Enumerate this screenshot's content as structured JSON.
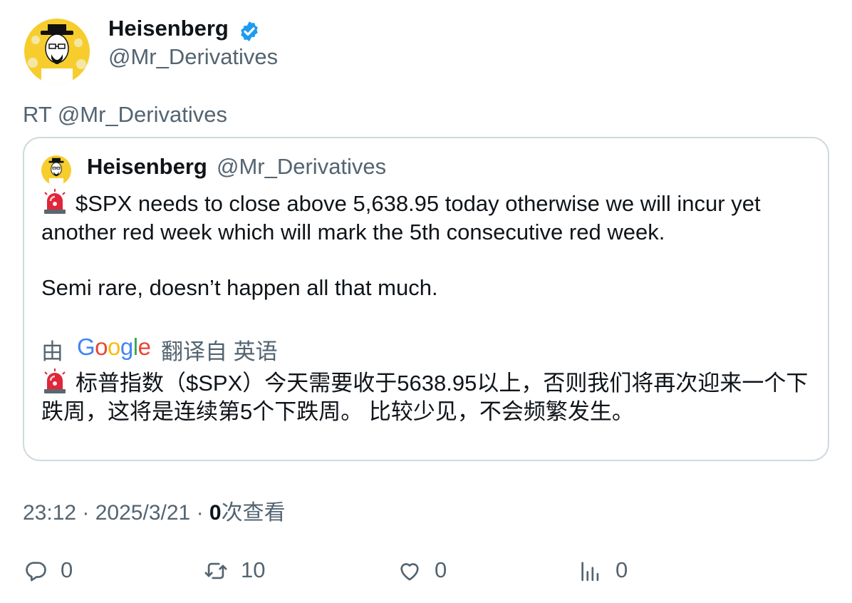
{
  "author": {
    "name": "Heisenberg",
    "handle": "@Mr_Derivatives",
    "avatar_icon": "heisenberg-avatar",
    "verified_icon": "verified-badge-icon",
    "verified_color": "#1d9bf0"
  },
  "retweet_line": "RT @Mr_Derivatives",
  "quote": {
    "name": "Heisenberg",
    "handle": "@Mr_Derivatives",
    "line1": "$SPX needs to close above 5,638.95 today otherwise we will incur yet another red week which will mark the 5th consecutive red week.",
    "line2": "Semi rare, doesn’t happen all that much.",
    "translate_by": "由",
    "translate_provider": "Google",
    "translate_from": "翻译自 英语",
    "translation": "标普指数（$SPX）今天需要收于5638.95以上，否则我们将再次迎来一个下跌周，这将是连续第5个下跌周。 比较少见，不会频繁发生。",
    "siren_icon": "siren-icon"
  },
  "meta": {
    "time": "23:12",
    "date": "2025/3/21",
    "views_count": "0",
    "views_label": "次查看"
  },
  "actions": {
    "replies": "0",
    "retweets": "10",
    "likes": "0",
    "views": "0"
  },
  "colors": {
    "text_primary": "#0f1419",
    "text_secondary": "#536471",
    "border": "#cfd9de",
    "accent": "#1d9bf0"
  }
}
